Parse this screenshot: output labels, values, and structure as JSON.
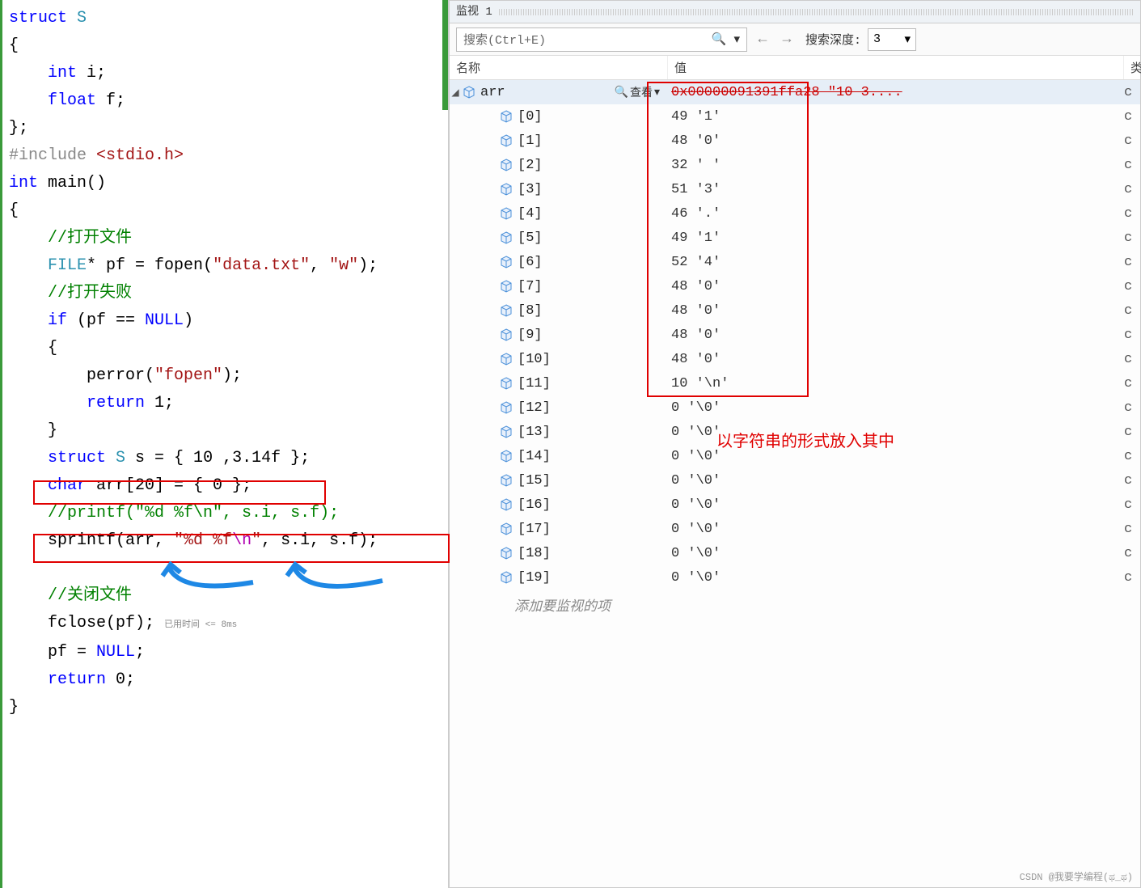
{
  "code": {
    "line1_kw": "struct",
    "line1_type": " S",
    "brace_open": "{",
    "line3_kw": "int",
    "line3_rest": " i;",
    "line4_kw": "float",
    "line4_rest": " f;",
    "brace_close": "};",
    "include": "#include ",
    "include_hdr": "<stdio.h>",
    "main_kw": "int",
    "main_sig": " main()",
    "cmt_open": "//打开文件",
    "file_type": "FILE",
    "file_rest": "* pf = fopen(",
    "file_str1": "\"data.txt\"",
    "file_mid": ", ",
    "file_str2": "\"w\"",
    "file_end": ");",
    "cmt_fail": "//打开失败",
    "if_kw": "if",
    "if_rest": " (pf == ",
    "null_kw": "NULL",
    "if_end": ")",
    "perror_call": "perror(",
    "perror_str": "\"fopen\"",
    "perror_end": ");",
    "return1_kw": "return",
    "return1_rest": " 1;",
    "struct_kw": "struct",
    "struct_type": " S",
    "struct_rest": " s = { 10 ,3.14f };",
    "char_kw": "char",
    "char_rest": " arr[20] = { 0 };",
    "cmt_printf": "//printf(\"%d %f\\n\", s.i, s.f);",
    "sprintf_call": "sprintf(arr, ",
    "sprintf_str1": "\"%d %f",
    "sprintf_esc": "\\n",
    "sprintf_str2": "\"",
    "sprintf_rest": ", s.i, s.f);",
    "cmt_close": "//关闭文件",
    "fclose_call": "fclose(pf);",
    "timer_text": "已用时间 <= 8ms",
    "pf_null": "pf = ",
    "pf_null_kw": "NULL",
    "pf_null_end": ";",
    "return0_kw": "return",
    "return0_rest": " 0;"
  },
  "watch": {
    "title": "监视 1",
    "search_placeholder": "搜索(Ctrl+E)",
    "depth_label": "搜索深度:",
    "depth_value": "3",
    "header_name": "名称",
    "header_value": "值",
    "header_type": "类",
    "root": {
      "name": "arr",
      "value": "0x00000091391ffa28 \"10 3....",
      "view": "查看",
      "type": "c"
    },
    "items": [
      {
        "idx": "[0]",
        "val": "49 '1'",
        "t": "c"
      },
      {
        "idx": "[1]",
        "val": "48 '0'",
        "t": "c"
      },
      {
        "idx": "[2]",
        "val": "32 ' '",
        "t": "c"
      },
      {
        "idx": "[3]",
        "val": "51 '3'",
        "t": "c"
      },
      {
        "idx": "[4]",
        "val": "46 '.'",
        "t": "c"
      },
      {
        "idx": "[5]",
        "val": "49 '1'",
        "t": "c"
      },
      {
        "idx": "[6]",
        "val": "52 '4'",
        "t": "c"
      },
      {
        "idx": "[7]",
        "val": "48 '0'",
        "t": "c"
      },
      {
        "idx": "[8]",
        "val": "48 '0'",
        "t": "c"
      },
      {
        "idx": "[9]",
        "val": "48 '0'",
        "t": "c"
      },
      {
        "idx": "[10]",
        "val": "48 '0'",
        "t": "c"
      },
      {
        "idx": "[11]",
        "val": "10 '\\n'",
        "t": "c"
      },
      {
        "idx": "[12]",
        "val": "0 '\\0'",
        "t": "c"
      },
      {
        "idx": "[13]",
        "val": "0 '\\0'",
        "t": "c"
      },
      {
        "idx": "[14]",
        "val": "0 '\\0'",
        "t": "c"
      },
      {
        "idx": "[15]",
        "val": "0 '\\0'",
        "t": "c"
      },
      {
        "idx": "[16]",
        "val": "0 '\\0'",
        "t": "c"
      },
      {
        "idx": "[17]",
        "val": "0 '\\0'",
        "t": "c"
      },
      {
        "idx": "[18]",
        "val": "0 '\\0'",
        "t": "c"
      },
      {
        "idx": "[19]",
        "val": "0 '\\0'",
        "t": "c"
      }
    ],
    "add_item": "添加要监视的项",
    "note": "以字符串的形式放入其中"
  },
  "watermark": "CSDN @我要学编程(ಥ_ಥ)"
}
